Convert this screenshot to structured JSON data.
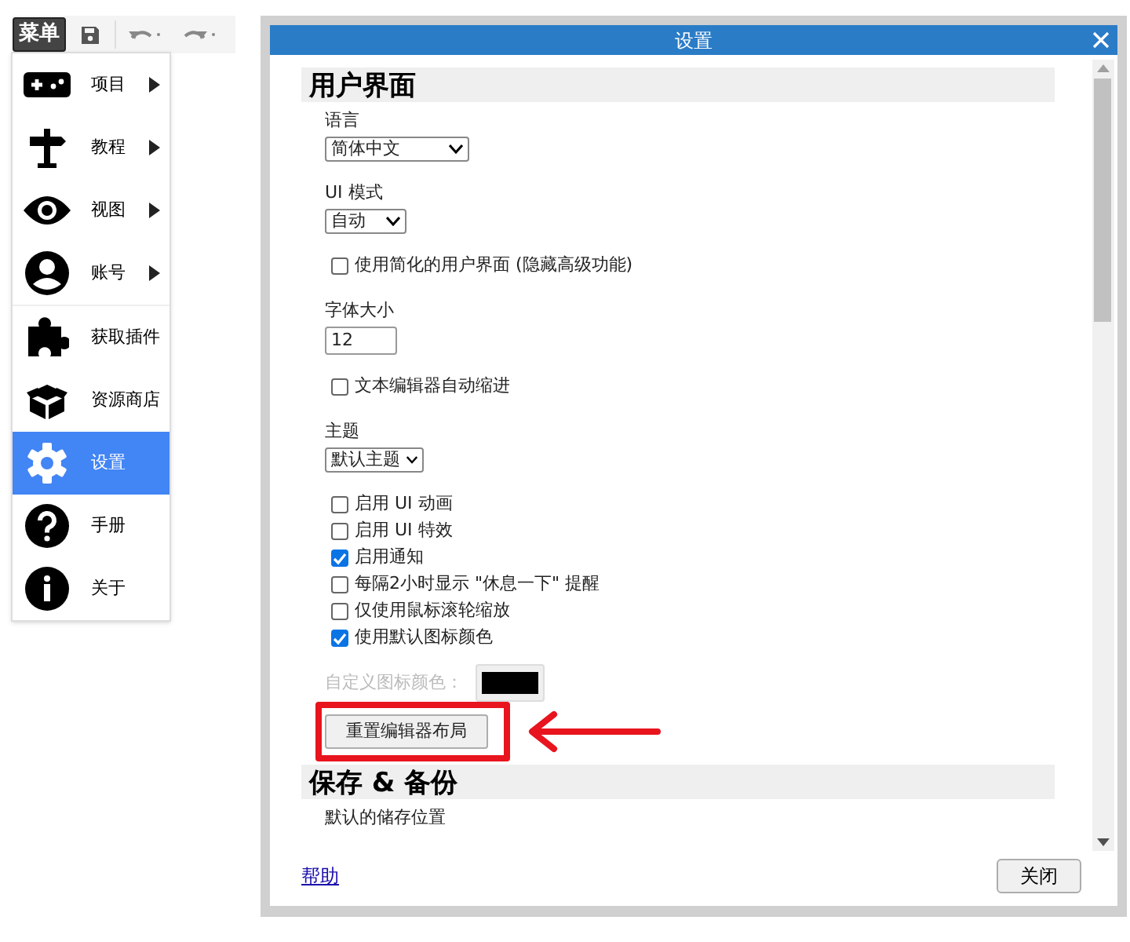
{
  "toolbar": {
    "menu_button": "菜单"
  },
  "menu": {
    "sections": [
      {
        "items": [
          {
            "label": "项目",
            "submenu": true,
            "selected": false
          },
          {
            "label": "教程",
            "submenu": true,
            "selected": false
          },
          {
            "label": "视图",
            "submenu": true,
            "selected": false
          },
          {
            "label": "账号",
            "submenu": true,
            "selected": false
          }
        ]
      },
      {
        "items": [
          {
            "label": "获取插件",
            "submenu": false,
            "selected": false
          },
          {
            "label": "资源商店",
            "submenu": false,
            "selected": false
          },
          {
            "label": "设置",
            "submenu": false,
            "selected": true
          },
          {
            "label": "手册",
            "submenu": false,
            "selected": false
          },
          {
            "label": "关于",
            "submenu": false,
            "selected": false
          }
        ]
      }
    ]
  },
  "dialog": {
    "title": "设置",
    "sections": [
      {
        "title": "用户界面",
        "items": [
          {
            "kind": "select",
            "label": "语言",
            "value": "简体中文"
          },
          {
            "kind": "select",
            "label": "UI 模式",
            "value": "自动"
          },
          {
            "kind": "checkbox",
            "label": "使用简化的用户界面 (隐藏高级功能)",
            "checked": false
          },
          {
            "kind": "number",
            "label": "字体大小",
            "value": "12"
          },
          {
            "kind": "checkbox",
            "label": "文本编辑器自动缩进",
            "checked": false
          },
          {
            "kind": "select",
            "label": "主题",
            "value": "默认主题"
          },
          {
            "kind": "checkbox",
            "label": "启用 UI 动画",
            "checked": false
          },
          {
            "kind": "checkbox",
            "label": "启用 UI 特效",
            "checked": false
          },
          {
            "kind": "checkbox",
            "label": "启用通知",
            "checked": true
          },
          {
            "kind": "checkbox",
            "label": "每隔2小时显示 \"休息一下\" 提醒",
            "checked": false
          },
          {
            "kind": "checkbox",
            "label": "仅使用鼠标滚轮缩放",
            "checked": false
          },
          {
            "kind": "checkbox",
            "label": "使用默认图标颜色",
            "checked": true
          },
          {
            "kind": "color",
            "label": "自定义图标颜色：",
            "disabled": true,
            "color": "#000000"
          },
          {
            "kind": "button",
            "label": "重置编辑器布局",
            "highlighted": true
          }
        ]
      },
      {
        "title": "保存 & 备份",
        "items": [
          {
            "kind": "text",
            "label": "默认的储存位置"
          }
        ]
      }
    ],
    "help_link": "帮助",
    "close_button": "关闭"
  }
}
